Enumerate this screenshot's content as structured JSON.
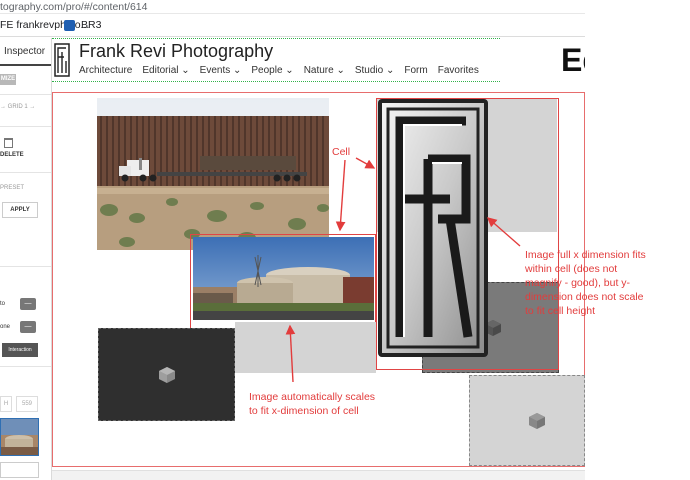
{
  "browser": {
    "url": "tography.com/pro/#/content/614",
    "bookmarks": [
      {
        "label": "FE frankrevphoto...",
        "icon": "page-icon"
      },
      {
        "label": "BR3",
        "icon": "bookmark-icon"
      }
    ]
  },
  "inspector": {
    "title": "Inspector",
    "maximize_label": "MIZE",
    "grid_label": "→ GRID 1 →",
    "delete_label": "DELETE",
    "preset_label": "PRESET",
    "apply_label": "APPLY",
    "row1_label": "to",
    "row2_label": "one",
    "dash": "—",
    "interaction_label": "Interaction",
    "dim_h_label": "H",
    "dim_value": "559"
  },
  "site": {
    "title": "Frank Revi Photography",
    "nav": [
      "Architecture",
      "Editorial ⌄",
      "Events ⌄",
      "People ⌄",
      "Nature ⌄",
      "Studio ⌄",
      "Form",
      "Favorites"
    ],
    "page_heading": "Ed"
  },
  "annotations": {
    "cell": "Cell",
    "right_note": [
      "Image full x dimension fits",
      "within cell (does not",
      "magnify - good), but y-",
      "dimension does not scale",
      "to fit cell height"
    ],
    "bottom_note": [
      "Image automatically scales",
      "to fit x-dimension of cell"
    ]
  },
  "colors": {
    "annotation": "#e23c3c",
    "header_outline": "#31b24a",
    "cell_fill": "#d4d4d4"
  }
}
